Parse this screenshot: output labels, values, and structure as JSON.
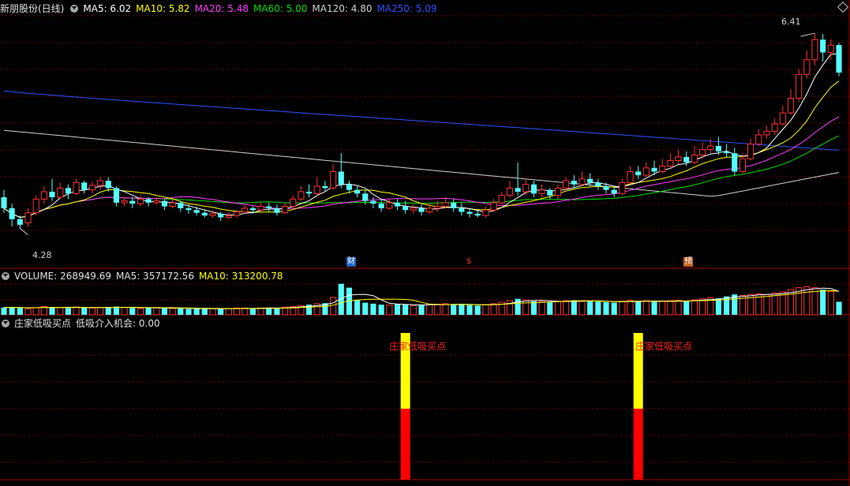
{
  "main_header": {
    "stock": "新朋股份(日线)",
    "ma5": "MA5: 6.02",
    "ma10": "MA10: 5.82",
    "ma20": "MA20: 5.48",
    "ma60": "MA60: 5.00",
    "ma120": "MA120: 4.80",
    "ma250": "MA250: 5.09",
    "colors": {
      "ma5": "#ffffff",
      "ma10": "#ffff00",
      "ma20": "#ff40ff",
      "ma60": "#00e000",
      "ma120": "#d0d0d0",
      "ma250": "#3050ff"
    }
  },
  "volume_header": {
    "volume": "VOLUME: 268949.69",
    "ma5": "MA5: 357172.56",
    "ma10": "MA10: 313200.78"
  },
  "indicator_header": {
    "name": "庄家低吸买点",
    "value": "低吸介入机会: 0.00"
  },
  "price_labels": {
    "high": "6.41",
    "low": "4.28"
  },
  "badges": {
    "cai": "财",
    "s": "$",
    "yu": "预"
  },
  "annotations": {
    "buy_point": "庄家低吸买点"
  },
  "chart_data": [
    {
      "type": "candlestick",
      "title": "新朋股份(日线)",
      "ylim": [
        4.0,
        6.6
      ],
      "high_marker": 6.41,
      "low_marker": 4.28,
      "candles": [
        [
          4.62,
          4.5,
          4.7,
          4.45
        ],
        [
          4.5,
          4.38,
          4.55,
          4.3
        ],
        [
          4.38,
          4.32,
          4.42,
          4.28
        ],
        [
          4.34,
          4.45,
          4.5,
          4.3
        ],
        [
          4.45,
          4.6,
          4.64,
          4.42
        ],
        [
          4.6,
          4.68,
          4.74,
          4.55
        ],
        [
          4.68,
          4.62,
          4.82,
          4.58
        ],
        [
          4.62,
          4.72,
          4.78,
          4.6
        ],
        [
          4.72,
          4.66,
          4.76,
          4.6
        ],
        [
          4.66,
          4.78,
          4.82,
          4.64
        ],
        [
          4.78,
          4.7,
          4.8,
          4.66
        ],
        [
          4.7,
          4.75,
          4.79,
          4.66
        ],
        [
          4.75,
          4.8,
          4.84,
          4.7
        ],
        [
          4.8,
          4.72,
          4.84,
          4.68
        ],
        [
          4.72,
          4.56,
          4.74,
          4.52
        ],
        [
          4.56,
          4.58,
          4.62,
          4.52
        ],
        [
          4.58,
          4.55,
          4.62,
          4.5
        ],
        [
          4.55,
          4.6,
          4.64,
          4.52
        ],
        [
          4.6,
          4.56,
          4.62,
          4.52
        ],
        [
          4.56,
          4.58,
          4.62,
          4.54
        ],
        [
          4.58,
          4.52,
          4.6,
          4.48
        ],
        [
          4.52,
          4.56,
          4.6,
          4.5
        ],
        [
          4.56,
          4.5,
          4.58,
          4.46
        ],
        [
          4.5,
          4.48,
          4.54,
          4.44
        ],
        [
          4.48,
          4.45,
          4.52,
          4.42
        ],
        [
          4.45,
          4.42,
          4.48,
          4.4
        ],
        [
          4.42,
          4.44,
          4.48,
          4.4
        ],
        [
          4.44,
          4.4,
          4.46,
          4.36
        ],
        [
          4.4,
          4.42,
          4.46,
          4.38
        ],
        [
          4.42,
          4.46,
          4.48,
          4.4
        ],
        [
          4.46,
          4.5,
          4.54,
          4.44
        ],
        [
          4.5,
          4.48,
          4.52,
          4.44
        ],
        [
          4.48,
          4.52,
          4.56,
          4.46
        ],
        [
          4.52,
          4.5,
          4.56,
          4.46
        ],
        [
          4.5,
          4.45,
          4.54,
          4.42
        ],
        [
          4.45,
          4.52,
          4.56,
          4.44
        ],
        [
          4.52,
          4.6,
          4.64,
          4.5
        ],
        [
          4.6,
          4.68,
          4.74,
          4.58
        ],
        [
          4.68,
          4.66,
          4.76,
          4.62
        ],
        [
          4.66,
          4.74,
          4.84,
          4.64
        ],
        [
          4.74,
          4.72,
          4.8,
          4.68
        ],
        [
          4.72,
          4.9,
          4.98,
          4.7
        ],
        [
          4.9,
          4.76,
          5.1,
          4.72
        ],
        [
          4.76,
          4.7,
          4.8,
          4.66
        ],
        [
          4.7,
          4.66,
          4.74,
          4.62
        ],
        [
          4.66,
          4.58,
          4.7,
          4.54
        ],
        [
          4.58,
          4.55,
          4.62,
          4.5
        ],
        [
          4.55,
          4.5,
          4.6,
          4.46
        ],
        [
          4.5,
          4.56,
          4.6,
          4.48
        ],
        [
          4.56,
          4.52,
          4.6,
          4.48
        ],
        [
          4.52,
          4.48,
          4.58,
          4.44
        ],
        [
          4.48,
          4.5,
          4.54,
          4.44
        ],
        [
          4.5,
          4.46,
          4.54,
          4.42
        ],
        [
          4.46,
          4.5,
          4.56,
          4.44
        ],
        [
          4.5,
          4.52,
          4.58,
          4.46
        ],
        [
          4.52,
          4.56,
          4.62,
          4.5
        ],
        [
          4.56,
          4.5,
          4.6,
          4.46
        ],
        [
          4.5,
          4.46,
          4.56,
          4.42
        ],
        [
          4.46,
          4.44,
          4.5,
          4.4
        ],
        [
          4.44,
          4.42,
          4.48,
          4.4
        ],
        [
          4.42,
          4.48,
          4.52,
          4.4
        ],
        [
          4.48,
          4.56,
          4.6,
          4.46
        ],
        [
          4.56,
          4.64,
          4.68,
          4.54
        ],
        [
          4.64,
          4.72,
          4.8,
          4.62
        ],
        [
          4.72,
          4.68,
          5.0,
          4.64
        ],
        [
          4.68,
          4.76,
          4.82,
          4.64
        ],
        [
          4.76,
          4.66,
          4.8,
          4.62
        ],
        [
          4.66,
          4.7,
          4.76,
          4.62
        ],
        [
          4.7,
          4.64,
          4.72,
          4.6
        ],
        [
          4.64,
          4.72,
          4.76,
          4.6
        ],
        [
          4.72,
          4.8,
          4.84,
          4.7
        ],
        [
          4.8,
          4.76,
          4.86,
          4.72
        ],
        [
          4.76,
          4.82,
          4.9,
          4.74
        ],
        [
          4.82,
          4.78,
          4.88,
          4.74
        ],
        [
          4.78,
          4.74,
          4.82,
          4.7
        ],
        [
          4.74,
          4.7,
          4.78,
          4.66
        ],
        [
          4.7,
          4.66,
          4.74,
          4.62
        ],
        [
          4.66,
          4.78,
          4.82,
          4.64
        ],
        [
          4.78,
          4.9,
          4.96,
          4.76
        ],
        [
          4.9,
          4.86,
          4.96,
          4.82
        ],
        [
          4.86,
          4.94,
          5.0,
          4.84
        ],
        [
          4.94,
          4.9,
          5.02,
          4.86
        ],
        [
          4.9,
          4.96,
          5.04,
          4.88
        ],
        [
          4.96,
          5.02,
          5.1,
          4.94
        ],
        [
          5.02,
          5.06,
          5.14,
          4.98
        ],
        [
          5.06,
          5.0,
          5.12,
          4.96
        ],
        [
          5.0,
          5.08,
          5.18,
          4.98
        ],
        [
          5.08,
          5.14,
          5.22,
          5.04
        ],
        [
          5.14,
          5.18,
          5.26,
          5.1
        ],
        [
          5.18,
          5.12,
          5.28,
          5.08
        ],
        [
          5.12,
          5.1,
          5.2,
          5.06
        ],
        [
          5.1,
          4.9,
          5.16,
          4.86
        ],
        [
          4.9,
          5.04,
          5.1,
          4.88
        ],
        [
          5.04,
          5.2,
          5.26,
          5.02
        ],
        [
          5.2,
          5.3,
          5.36,
          5.18
        ],
        [
          5.3,
          5.34,
          5.4,
          5.26
        ],
        [
          5.34,
          5.42,
          5.48,
          5.3
        ],
        [
          5.42,
          5.54,
          5.62,
          5.4
        ],
        [
          5.54,
          5.7,
          5.8,
          5.52
        ],
        [
          5.7,
          5.96,
          6.02,
          5.66
        ],
        [
          5.96,
          6.12,
          6.22,
          5.92
        ],
        [
          6.12,
          6.34,
          6.41,
          6.06
        ],
        [
          6.34,
          6.2,
          6.4,
          6.1
        ],
        [
          6.2,
          6.28,
          6.34,
          6.12
        ],
        [
          6.28,
          5.98,
          6.3,
          5.94
        ]
      ]
    },
    {
      "type": "bar",
      "title": "VOLUME",
      "values": [
        150000,
        160000,
        140000,
        130000,
        150000,
        170000,
        160000,
        150000,
        140000,
        160000,
        150000,
        140000,
        150000,
        160000,
        170000,
        150000,
        140000,
        130000,
        140000,
        150000,
        140000,
        130000,
        130000,
        120000,
        130000,
        120000,
        130000,
        120000,
        130000,
        140000,
        140000,
        130000,
        140000,
        150000,
        140000,
        160000,
        170000,
        190000,
        210000,
        230000,
        240000,
        360000,
        640000,
        560000,
        300000,
        250000,
        230000,
        210000,
        200000,
        220000,
        210000,
        190000,
        200000,
        210000,
        220000,
        230000,
        220000,
        210000,
        200000,
        190000,
        210000,
        230000,
        260000,
        290000,
        330000,
        310000,
        280000,
        270000,
        260000,
        270000,
        290000,
        300000,
        280000,
        290000,
        270000,
        260000,
        250000,
        280000,
        300000,
        280000,
        290000,
        270000,
        280000,
        290000,
        300000,
        280000,
        310000,
        330000,
        350000,
        340000,
        380000,
        420000,
        400000,
        420000,
        430000,
        420000,
        450000,
        470000,
        520000,
        560000,
        580000,
        560000,
        520000,
        480000,
        268950
      ]
    },
    {
      "type": "bar",
      "title": "庄家低吸买点",
      "values": [
        0,
        0,
        0,
        0,
        0,
        0,
        0,
        0,
        0,
        0,
        0,
        0,
        0,
        0,
        0,
        0,
        0,
        0,
        0,
        0,
        0,
        0,
        0,
        0,
        0,
        0,
        0,
        0,
        0,
        0,
        0,
        0,
        0,
        0,
        0,
        0,
        0,
        0,
        0,
        0,
        0,
        0,
        0,
        0,
        0,
        0,
        0,
        0,
        0,
        0,
        1,
        0,
        0,
        0,
        0,
        0,
        0,
        0,
        0,
        0,
        0,
        0,
        0,
        0,
        0,
        0,
        0,
        0,
        0,
        0,
        0,
        0,
        0,
        0,
        0,
        0,
        0,
        0,
        0,
        1,
        0,
        0,
        0,
        0,
        0,
        0,
        0,
        0,
        0,
        0,
        0,
        0,
        0,
        0,
        0,
        0,
        0,
        0,
        0,
        0,
        0,
        0,
        0,
        0,
        0
      ]
    }
  ]
}
